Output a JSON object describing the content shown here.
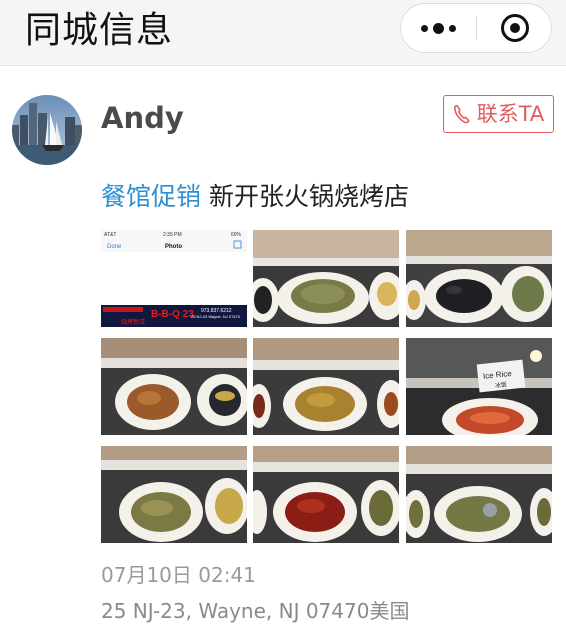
{
  "navbar": {
    "title": "同城信息",
    "more_icon": "more-dots-icon",
    "close_icon": "target-close-icon"
  },
  "post": {
    "username": "Andy",
    "contact_label": "联系TA",
    "contact_icon": "phone-icon",
    "category": "餐馆促销",
    "text": "新开张火锅烧烤店",
    "time": "07月10日 02:41",
    "location": "25 NJ-23, Wayne, NJ 07470美国"
  },
  "photos": [
    {
      "kind": "screenshot",
      "carrier": "AT&T",
      "clock": "2:35 PM",
      "battery": "60%",
      "back": "Done",
      "screen_title": "Photo",
      "sign": "B-B-Q 23",
      "sign_phone": "973.837.6212",
      "sign_address": "25 NJ-23 Wayne, NJ 07470",
      "sign_sub": "烧烤新店"
    },
    {
      "kind": "food",
      "dish": "fish"
    },
    {
      "kind": "food",
      "dish": "mussels"
    },
    {
      "kind": "food",
      "dish": "chicken"
    },
    {
      "kind": "food",
      "dish": "tofu"
    },
    {
      "kind": "food",
      "dish": "buffet-sign",
      "label_en": "Ice Rice",
      "label_cn": "冰饭"
    },
    {
      "kind": "food",
      "dish": "fish"
    },
    {
      "kind": "food",
      "dish": "crayfish"
    },
    {
      "kind": "food",
      "dish": "fish"
    }
  ],
  "colors": {
    "accent_blue": "#2f8fd0",
    "contact_red": "#e45b5b",
    "meta_gray": "#9a9a9a"
  }
}
